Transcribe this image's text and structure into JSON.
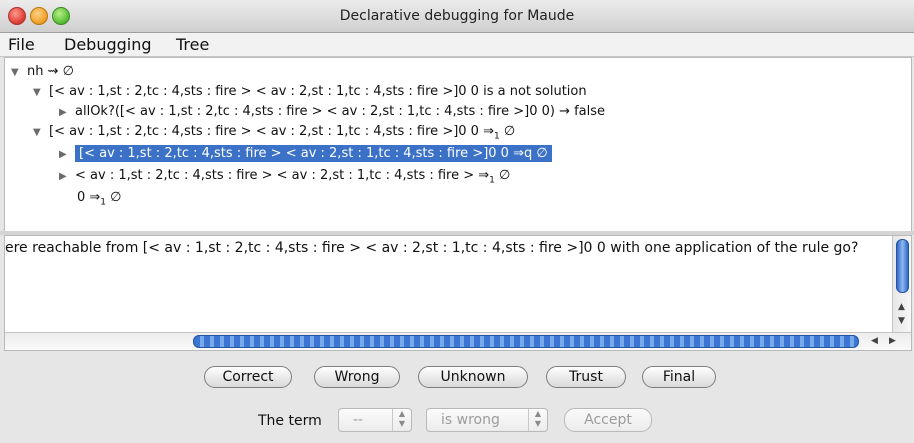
{
  "window": {
    "title": "Declarative debugging for Maude"
  },
  "menu": {
    "file": "File",
    "debugging": "Debugging",
    "tree": "Tree"
  },
  "tree": {
    "root": "nh ⇝ ∅",
    "n1": "[< av : 1,st : 2,tc : 4,sts : fire > < av : 2,st : 1,tc : 4,sts : fire >]0 0 is a not solution",
    "n1_child": "allOk?([< av : 1,st : 2,tc : 4,sts : fire > < av : 2,st : 1,tc : 4,sts : fire >]0 0) → false",
    "n2_prefix": "[< av : 1,st : 2,tc : 4,sts : fire > < av : 2,st : 1,tc : 4,sts : fire >]0 0 ⇒",
    "n2_sub": "1",
    "n2_suffix": " ∅",
    "n2_child1_selected": "[< av : 1,st : 2,tc : 4,sts : fire > < av : 2,st : 1,tc : 4,sts : fire >]0 0 ⇒q ∅",
    "n2_child2_prefix": "< av : 1,st : 2,tc : 4,sts : fire > < av : 2,st : 1,tc : 4,sts : fire > ⇒",
    "n2_child2_sub": "1",
    "n2_child2_suffix": " ∅",
    "n2_child3_prefix": "0 ⇒",
    "n2_child3_sub": "1",
    "n2_child3_suffix": " ∅"
  },
  "question": {
    "text": "ere reachable from [< av : 1,st : 2,tc : 4,sts : fire > < av : 2,st : 1,tc : 4,sts : fire >]0 0 with one application of the rule go?"
  },
  "buttons": {
    "correct": "Correct",
    "wrong": "Wrong",
    "unknown": "Unknown",
    "trust": "Trust",
    "final": "Final"
  },
  "bottom": {
    "term_label": "The term",
    "term_select": "--",
    "verdict_select": "is wrong",
    "accept": "Accept"
  },
  "icons": {
    "expanded": "triangle-down-icon",
    "collapsed": "triangle-right-icon",
    "scroll_up": "scroll-up-arrow-icon",
    "scroll_down": "scroll-down-arrow-icon",
    "scroll_left": "scroll-left-arrow-icon",
    "scroll_right": "scroll-right-arrow-icon"
  },
  "colors": {
    "selection": "#3b72c8",
    "scroll_thumb": "#3a76d2"
  }
}
